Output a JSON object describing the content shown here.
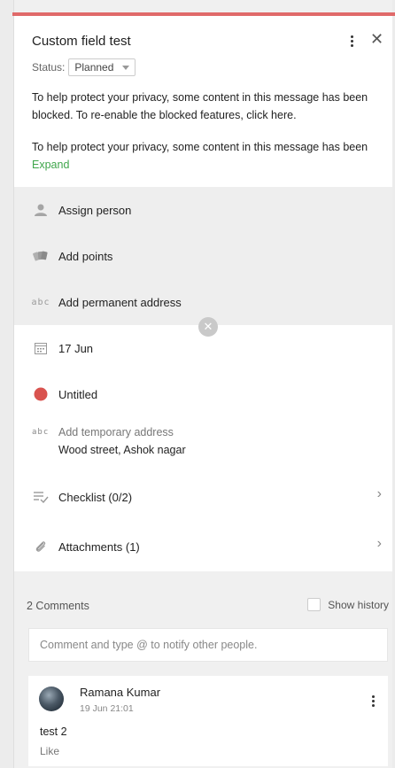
{
  "task": {
    "title": "Custom field test",
    "status_label": "Status:",
    "status_value": "Planned"
  },
  "notices": {
    "privacy_1": "To help protect your privacy, some content in this message has been blocked. To re-enable the blocked features, click here.",
    "privacy_2": "To help protect your privacy, some content in this message has been",
    "expand_label": "Expand"
  },
  "fields": {
    "assign_person": "Assign person",
    "add_points": "Add points",
    "add_permanent_address": "Add permanent address",
    "date": "17 Jun",
    "untitled": "Untitled",
    "add_temporary_address": "Add temporary address",
    "temporary_address_value": "Wood street, Ashok nagar",
    "checklist": "Checklist (0/2)",
    "attachments": "Attachments (1)",
    "abc_glyph": "abc"
  },
  "colors": {
    "accent_bar": "#e06a6a",
    "status_dot": "#d9534f",
    "expand_link": "#3fa64b"
  },
  "comments": {
    "count_label": "2 Comments",
    "show_history_label": "Show history",
    "input_placeholder": "Comment and type @ to notify other people.",
    "items": [
      {
        "author": "Ramana Kumar",
        "time": "19 Jun 21:01",
        "text": "test 2",
        "like_label": "Like"
      }
    ]
  }
}
